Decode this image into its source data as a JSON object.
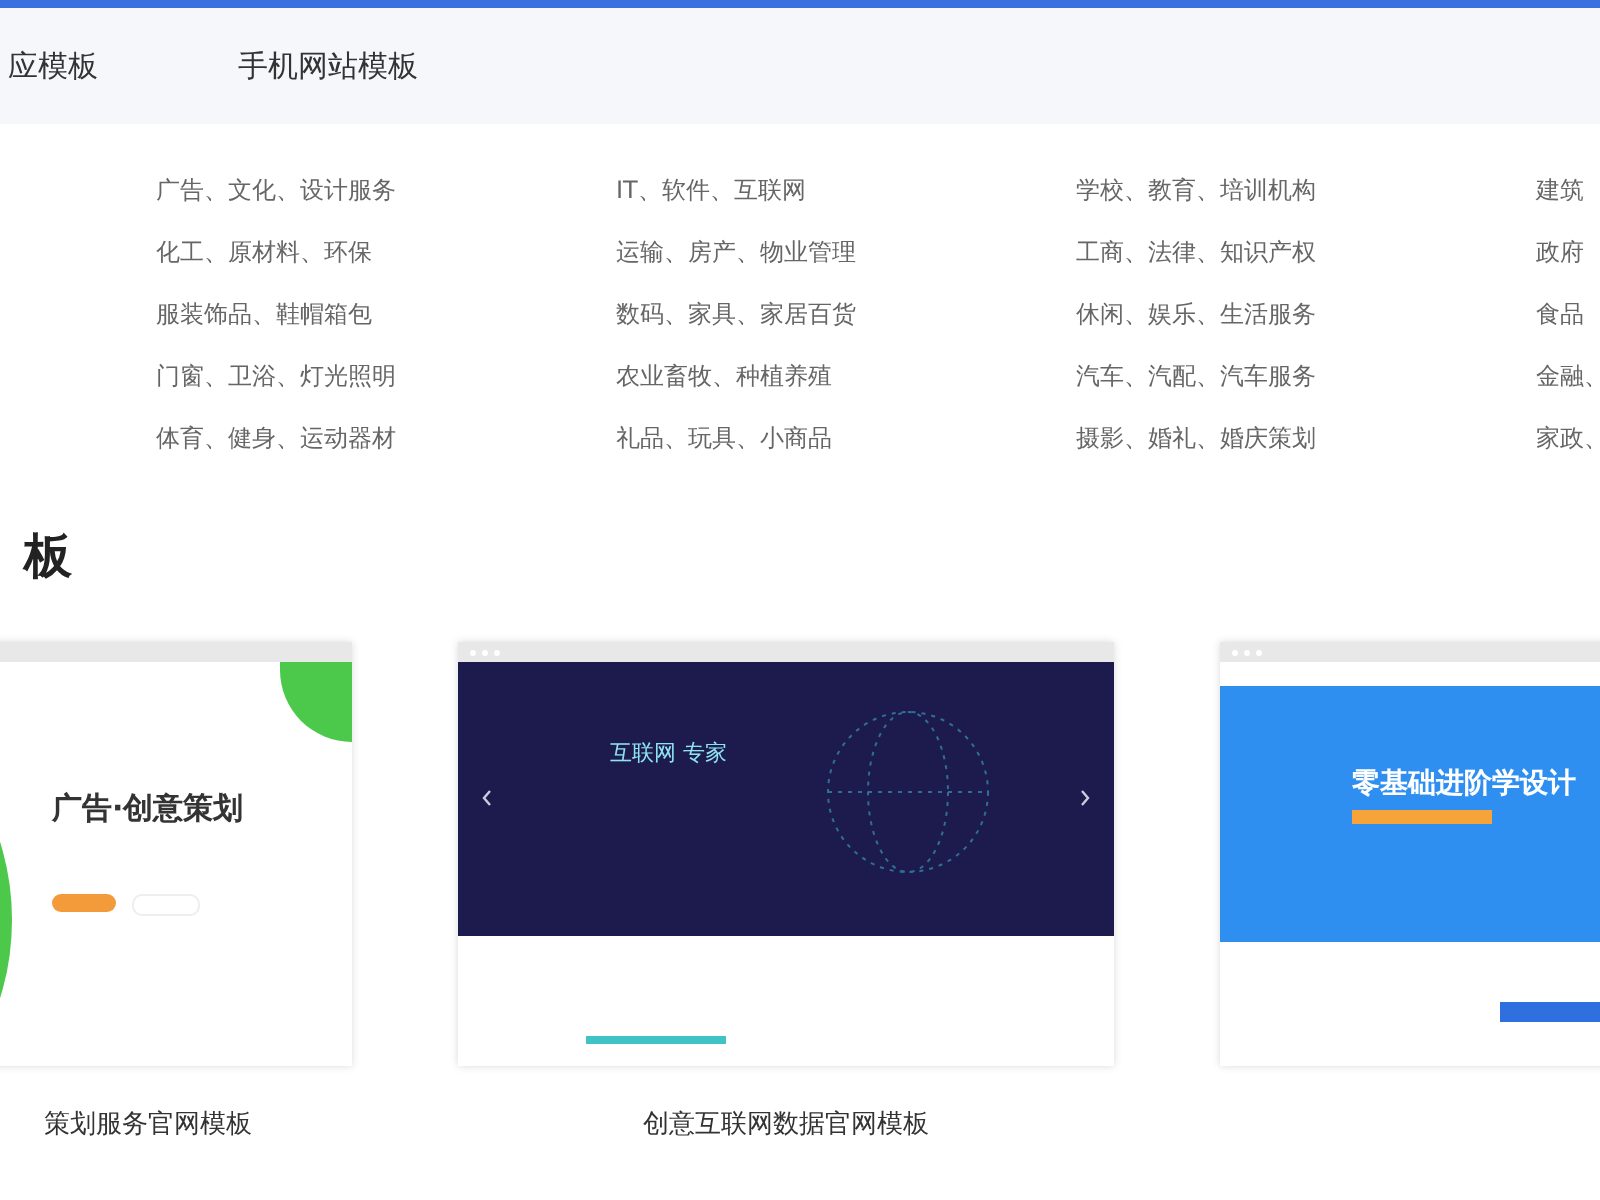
{
  "tabs": [
    {
      "label": "应模板",
      "selected": false
    },
    {
      "label": "手机网站模板",
      "selected": false
    }
  ],
  "categories": [
    [
      "广告、文化、设计服务",
      "IT、软件、互联网",
      "学校、教育、培训机构",
      "建筑"
    ],
    [
      "化工、原材料、环保",
      "运输、房产、物业管理",
      "工商、法律、知识产权",
      "政府"
    ],
    [
      "服装饰品、鞋帽箱包",
      "数码、家具、家居百货",
      "休闲、娱乐、生活服务",
      "食品"
    ],
    [
      "门窗、卫浴、灯光照明",
      "农业畜牧、种植养殖",
      "汽车、汽配、汽车服务",
      "金融、"
    ],
    [
      "体育、健身、运动器材",
      "礼品、玩具、小商品",
      "摄影、婚礼、婚庆策划",
      "家政、"
    ]
  ],
  "section_title": "板",
  "templates": [
    {
      "kind": "green",
      "headline": "广告·创意策划",
      "caption": "策划服务官网模板"
    },
    {
      "kind": "dark",
      "headline": "互联网 专家",
      "caption": "创意互联网数据官网模板"
    },
    {
      "kind": "blue",
      "headline": "零基础进阶学设计"
    }
  ]
}
